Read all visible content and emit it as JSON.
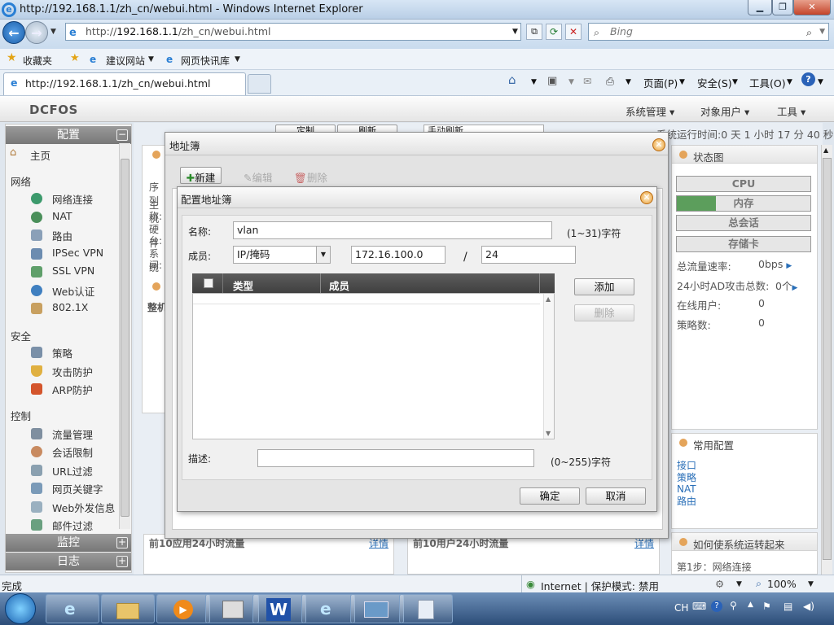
{
  "browser": {
    "title": "http://192.168.1.1/zh_cn/webui.html - Windows Internet Explorer",
    "address_prefix": "http://",
    "address_host": "192.168.1.1",
    "address_path": "/zh_cn/webui.html",
    "search_placeholder": "Bing",
    "favorites": "收藏夹",
    "suggested_sites": "建议网站",
    "web_slice": "网页快讯库",
    "tab_title": "http://192.168.1.1/zh_cn/webui.html",
    "cmd_page": "页面(P)",
    "cmd_safety": "安全(S)",
    "cmd_tools": "工具(O)"
  },
  "app": {
    "logo": "DCFOS",
    "menu": [
      "系统管理",
      "对象用户",
      "工具"
    ],
    "runtime": "系统运行时间:0 天 1 小时 17 分 40 秒",
    "bg_customize": "定制",
    "bg_refresh": "刷新",
    "bg_manual_refresh": "手动刷新"
  },
  "sidebar": {
    "config_title": "配置",
    "home": "主页",
    "groups": [
      {
        "title": "网络",
        "items": [
          "网络连接",
          "NAT",
          "路由",
          "IPSec VPN",
          "SSL VPN",
          "Web认证",
          "802.1X"
        ]
      },
      {
        "title": "安全",
        "items": [
          "策略",
          "攻击防护",
          "ARP防护"
        ]
      },
      {
        "title": "控制",
        "items": [
          "流量管理",
          "会话限制",
          "URL过滤",
          "网页关键字",
          "Web外发信息",
          "邮件过滤"
        ]
      }
    ],
    "monitor_title": "监控",
    "log_title": "日志"
  },
  "status_panel": {
    "title": "状态图",
    "bars": [
      "CPU",
      "内存",
      "总会话",
      "存储卡"
    ],
    "memory_fill_fraction": 0.29,
    "rows": [
      {
        "label": "总流量速率:",
        "value": "0bps"
      },
      {
        "label": "24小时AD攻击总数:",
        "value": "0个"
      },
      {
        "label": "在线用户:",
        "value": "0"
      },
      {
        "label": "策略数:",
        "value": "0"
      }
    ]
  },
  "common_panel": {
    "title": "常用配置",
    "links": [
      "接口",
      "策略",
      "NAT",
      "路由"
    ]
  },
  "howto_panel": {
    "title": "如何使系统运转起来",
    "step1": "第1步：网络连接"
  },
  "bottom_panels": {
    "left_title": "前10应用24小时流量",
    "right_title": "前10用户24小时流量",
    "details": "详情"
  },
  "bg_left_fragments": {
    "serial": "序列",
    "row1": "主机",
    "row2": "称:",
    "row3": "硬件",
    "row4": "台:",
    "row5": "系统",
    "row6": "间:",
    "whole": "整机"
  },
  "addr_book_dialog": {
    "title": "地址簿",
    "new": "新建",
    "edit": "编辑",
    "delete": "删除"
  },
  "config_dialog": {
    "title": "配置地址簿",
    "name_label": "名称:",
    "name_value": "vlan",
    "name_hint": "(1~31)字符",
    "member_label": "成员:",
    "member_type": "IP/掩码",
    "ip_value": "172.16.100.0",
    "slash": "/",
    "mask_value": "24",
    "col_type": "类型",
    "col_member": "成员",
    "add_btn": "添加",
    "remove_btn": "删除",
    "desc_label": "描述:",
    "desc_value": "",
    "desc_hint": "(0~255)字符",
    "ok_btn": "确定",
    "cancel_btn": "取消"
  },
  "statusbar": {
    "left": "完成",
    "zone": "Internet | 保护模式: 禁用",
    "zoom": "100%"
  },
  "taskbar": {
    "lang": "CH"
  }
}
